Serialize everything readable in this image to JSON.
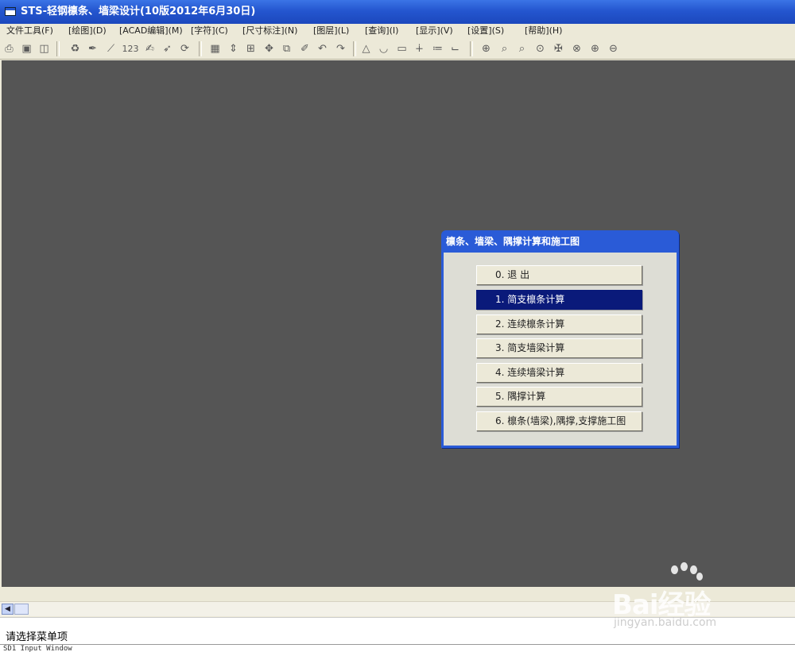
{
  "window": {
    "title": "STS-轻钢檩条、墙梁设计(10版2012年6月30日)"
  },
  "menu": [
    {
      "label": "文件工具(F)"
    },
    {
      "label": "[绘图](D)"
    },
    {
      "label": "[ACAD编辑](M)"
    },
    {
      "label": "[字符](C)"
    },
    {
      "label": "[尺寸标注](N)"
    },
    {
      "label": "[图层](L)"
    },
    {
      "label": "[查询](I)"
    },
    {
      "label": "[显示](V)"
    },
    {
      "label": "[设置](S)"
    },
    {
      "label": "[帮助](H)"
    }
  ],
  "toolbar": {
    "number_label": "123",
    "icons": [
      "print-icon",
      "save-icon",
      "export-icon",
      "redraw-icon",
      "pen-icon",
      "line-icon",
      "number-icon",
      "text-icon",
      "char-icon",
      "rotate-icon",
      "grid-icon",
      "move-vertical-icon",
      "window-icon",
      "pan-icon",
      "copy-icon",
      "brush-icon",
      "undo-icon",
      "redo-icon",
      "polygon-icon",
      "arc-icon",
      "rect-icon",
      "break-icon",
      "extend-icon",
      "fillet-icon",
      "zoom-window-icon",
      "zoom-realtime-icon",
      "zoom-prev-icon",
      "zoom-all-icon",
      "zoom-pan-icon",
      "zoom-extent-icon",
      "zoom-in-icon",
      "zoom-out-icon"
    ]
  },
  "dialog": {
    "title": "檩条、墙梁、隅撑计算和施工图",
    "buttons": [
      {
        "label": "0.  退   出",
        "selected": false
      },
      {
        "label": "1.  简支檩条计算",
        "selected": true
      },
      {
        "label": "2.  连续檩条计算",
        "selected": false
      },
      {
        "label": "3.  简支墙梁计算",
        "selected": false
      },
      {
        "label": "4.  连续墙梁计算",
        "selected": false
      },
      {
        "label": "5.  隅撑计算",
        "selected": false
      },
      {
        "label": "6.  檩条(墙梁),隅撑,支撑施工图",
        "selected": false
      }
    ]
  },
  "prompt": {
    "text": "请选择菜单项"
  },
  "bottom_strip": {
    "text": "SD1 Input Window"
  },
  "watermark": {
    "brand": "Bai经验",
    "url": "jingyan.baidu.com"
  },
  "colors": {
    "canvas": "#555555",
    "titlebar": "#2456cf",
    "dialog_frame": "#2a5bd7",
    "selected_button": "#0a1a7a"
  }
}
